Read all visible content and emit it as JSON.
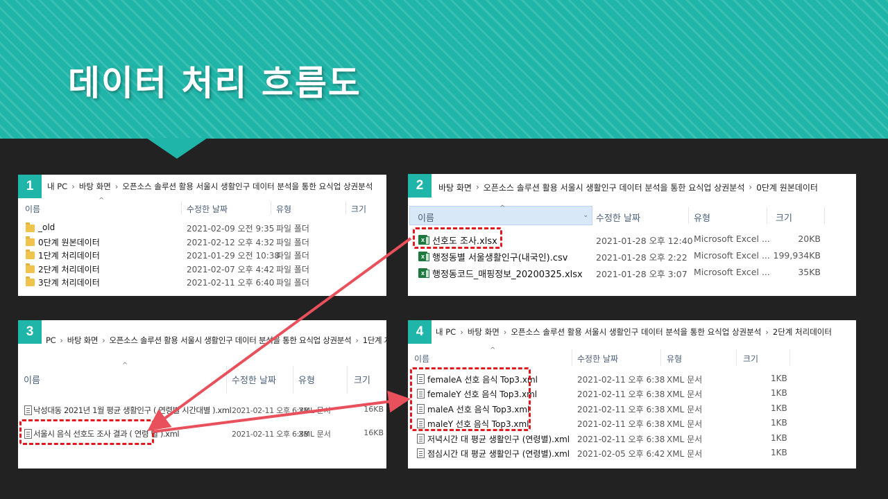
{
  "title": "데이터 처리 흐름도",
  "colors": {
    "accent": "#1fb5a8",
    "arrow": "#e8505b",
    "highlight": "#e0181f",
    "background": "#222222"
  },
  "icons": {
    "folder": "folder-icon",
    "excel": "excel-file-icon",
    "xml": "xml-file-icon",
    "caret": "sort-caret-icon"
  },
  "panels": [
    {
      "badge": "1",
      "breadcrumb": [
        "내 PC",
        "바탕 화면",
        "오픈소스 솔루션 활용 서울시 생활인구 데이터 분석을 통한 요식업 상권분석"
      ],
      "columns": [
        "이름",
        "수정한 날짜",
        "유형",
        "크기"
      ],
      "rows": [
        {
          "name": "_old",
          "date": "2021-02-09 오전 9:35",
          "type": "파일 폴더",
          "size": ""
        },
        {
          "name": "0단계 원본데이터",
          "date": "2021-02-12 오후 4:32",
          "type": "파일 폴더",
          "size": ""
        },
        {
          "name": "1단계 처리데이터",
          "date": "2021-01-29 오전 10:38",
          "type": "파일 폴더",
          "size": ""
        },
        {
          "name": "2단계 처리데이터",
          "date": "2021-02-07 오후 4:42",
          "type": "파일 폴더",
          "size": ""
        },
        {
          "name": "3단계 처리데이터",
          "date": "2021-02-11 오후 6:40",
          "type": "파일 폴더",
          "size": ""
        }
      ]
    },
    {
      "badge": "2",
      "breadcrumb": [
        "바탕 화면",
        "오픈소스 솔루션 활용 서울시 생활인구 데이터 분석을 통한 요식업 상권분석",
        "0단계 원본데이터"
      ],
      "columns": [
        "이름",
        "수정한 날짜",
        "유형",
        "크기"
      ],
      "rows": [
        {
          "name": "선호도 조사.xlsx",
          "date": "2021-01-28 오후 12:40",
          "type": "Microsoft Excel ...",
          "size": "20KB"
        },
        {
          "name": "행정동별 서울생활인구(내국인).csv",
          "date": "2021-01-28 오후 2:22",
          "type": "Microsoft Excel ...",
          "size": "199,934KB"
        },
        {
          "name": "행정동코드_매핑정보_20200325.xlsx",
          "date": "2021-01-28 오후 3:07",
          "type": "Microsoft Excel ...",
          "size": "35KB"
        }
      ]
    },
    {
      "badge": "3",
      "breadcrumb": [
        "PC",
        "바탕 화면",
        "오픈소스 솔루션 활용 서울시 생활인구 데이터 분석을 통한 요식업 상권분석",
        "1단계 처리데이터"
      ],
      "columns": [
        "이름",
        "수정한 날짜",
        "유형",
        "크기"
      ],
      "rows": [
        {
          "name": "낙성대동 2021년 1월 평균 생활인구 ( 연령별 시간대별 ).xml",
          "date": "2021-02-11 오후 6:38",
          "type": "XML 문서",
          "size": "16KB"
        },
        {
          "name": "서울시 음식 선호도 조사 결과 ( 연령 별 ).xml",
          "date": "2021-02-11 오후 6:38",
          "type": "XML 문서",
          "size": "16KB"
        }
      ]
    },
    {
      "badge": "4",
      "breadcrumb": [
        "내 PC",
        "바탕 화면",
        "오픈소스 솔루션 활용 서울시 생활인구 데이터 분석을 통한 요식업 상권분석",
        "2단계 처리데이터"
      ],
      "columns": [
        "이름",
        "수정한 날짜",
        "유형",
        "크기"
      ],
      "rows": [
        {
          "name": "femaleA 선호 음식 Top3.xml",
          "date": "2021-02-11 오후 6:38",
          "type": "XML 문서",
          "size": "1KB"
        },
        {
          "name": "femaleY 선호 음식 Top3.xml",
          "date": "2021-02-11 오후 6:38",
          "type": "XML 문서",
          "size": "1KB"
        },
        {
          "name": "maleA 선호 음식 Top3.xml",
          "date": "2021-02-11 오후 6:38",
          "type": "XML 문서",
          "size": "1KB"
        },
        {
          "name": "maleY 선호 음식 Top3.xml",
          "date": "2021-02-11 오후 6:38",
          "type": "XML 문서",
          "size": "1KB"
        },
        {
          "name": "저녁시간 대 평균 생활인구 (연령별).xml",
          "date": "2021-02-11 오후 6:38",
          "type": "XML 문서",
          "size": "1KB"
        },
        {
          "name": "점심시간 대 평균 생활인구 (연령별).xml",
          "date": "2021-02-05 오후 6:42",
          "type": "XML 문서",
          "size": "1KB"
        }
      ]
    }
  ]
}
